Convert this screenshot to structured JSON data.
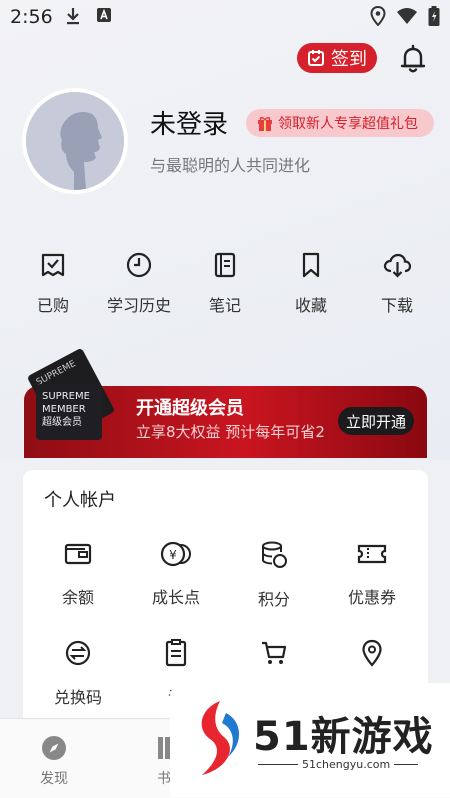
{
  "status_bar": {
    "time": "2:56"
  },
  "header": {
    "checkin_label": "签到"
  },
  "profile": {
    "username": "未登录",
    "gift_text": "领取新人专享超值礼包",
    "slogan": "与最聪明的人共同进化"
  },
  "quick": [
    {
      "label": "已购",
      "icon": "purchased-icon"
    },
    {
      "label": "学习历史",
      "icon": "history-clock-icon"
    },
    {
      "label": "笔记",
      "icon": "notes-icon"
    },
    {
      "label": "收藏",
      "icon": "bookmark-icon"
    },
    {
      "label": "下载",
      "icon": "download-icon"
    }
  ],
  "vip": {
    "card_line1": "SUPREME",
    "card_line2": "MEMBER",
    "card_line3": "超级会员",
    "title": "开通超级会员",
    "subtitle": "立享8大权益 预计每年可省2",
    "button": "立即开通"
  },
  "account": {
    "title": "个人帐户",
    "items": [
      {
        "label": "余额",
        "icon": "wallet-icon"
      },
      {
        "label": "成长点",
        "icon": "coins-icon"
      },
      {
        "label": "积分",
        "icon": "points-stack-icon"
      },
      {
        "label": "优惠券",
        "icon": "coupon-icon"
      },
      {
        "label": "兑换码",
        "icon": "redeem-code-icon"
      },
      {
        "label": "订",
        "icon": "order-clipboard-icon"
      },
      {
        "label": "",
        "icon": "cart-icon"
      },
      {
        "label": "",
        "icon": "location-pin-icon"
      }
    ]
  },
  "nav": {
    "discover": "发现",
    "books": "书"
  },
  "watermark": {
    "brand": "51新游戏",
    "site": "51chengyu.com"
  },
  "colors": {
    "accent": "#d6202b",
    "vip_dark": "#1b1b1d"
  }
}
